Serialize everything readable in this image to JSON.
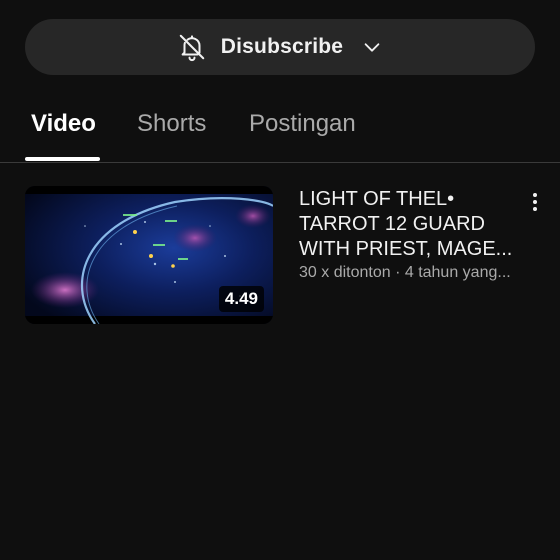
{
  "subscribe": {
    "label": "Disubscribe",
    "bell_icon": "bell-off-icon",
    "chevron_icon": "chevron-down-icon"
  },
  "tabs": [
    {
      "label": "Video",
      "active": true
    },
    {
      "label": "Shorts",
      "active": false
    },
    {
      "label": "Postingan",
      "active": false
    }
  ],
  "videos": [
    {
      "title": "LIGHT OF THEL• TARROT 12 GUARD WITH PRIEST, MAGE...",
      "duration": "4.49",
      "stats": "30 x ditonton · 4 tahun yang...",
      "menu_icon": "more-vert-icon"
    }
  ],
  "colors": {
    "background": "#0f0f0f",
    "pill": "#272727",
    "text_primary": "#f1f1f1",
    "text_secondary": "#aaaaaa",
    "divider": "#3a3a3a"
  }
}
